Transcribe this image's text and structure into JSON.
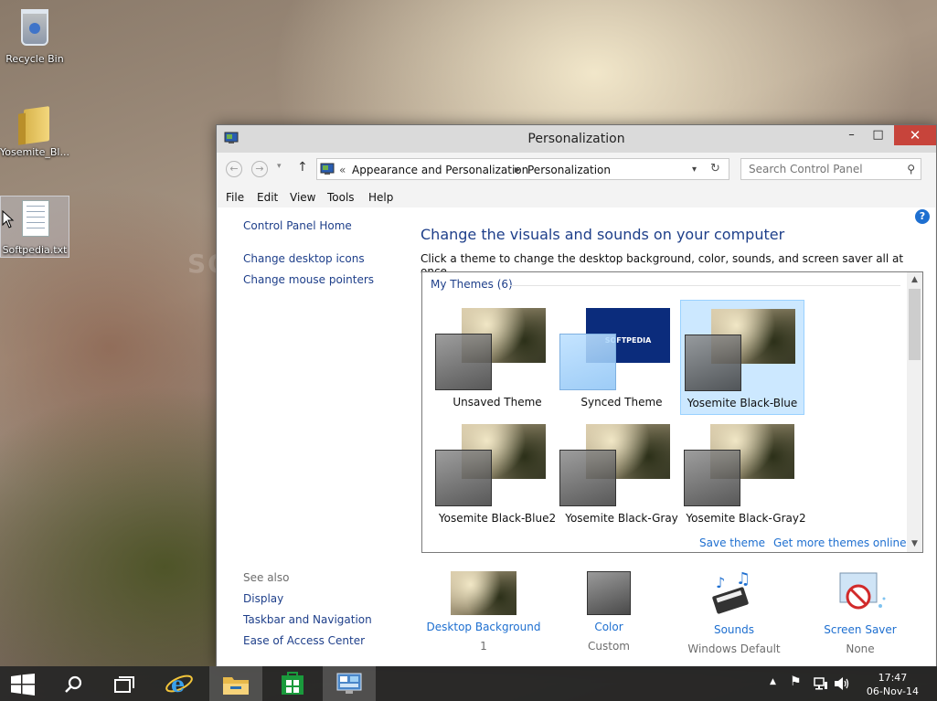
{
  "desktop": {
    "icons": [
      {
        "label": "Recycle Bin",
        "icon": "recycle-bin-icon"
      },
      {
        "label": "Yosemite_Bl...",
        "icon": "folder-icon"
      },
      {
        "label": "Softpedia.txt",
        "icon": "text-file-icon"
      }
    ],
    "watermark": "SOFTPEDIA"
  },
  "window": {
    "title": "Personalization",
    "controls": {
      "minimize": "–",
      "maximize": "□",
      "close": "✕"
    },
    "address": {
      "overflow": "«",
      "crumbs": [
        "Appearance and Personalization",
        "Personalization"
      ]
    },
    "search": {
      "placeholder": "Search Control Panel"
    },
    "menu": [
      "File",
      "Edit",
      "View",
      "Tools",
      "Help"
    ]
  },
  "sidebar": {
    "home": "Control Panel Home",
    "links": [
      "Change desktop icons",
      "Change mouse pointers"
    ],
    "see_also_label": "See also",
    "see_also": [
      "Display",
      "Taskbar and Navigation",
      "Ease of Access Center"
    ]
  },
  "main": {
    "heading": "Change the visuals and sounds on your computer",
    "subtext": "Click a theme to change the desktop background, color, sounds, and screen saver all at once.",
    "group_label": "My Themes (6)",
    "themes": [
      {
        "name": "Unsaved Theme",
        "selected": false
      },
      {
        "name": "Synced Theme",
        "selected": false,
        "thumb_text": "SOFTPEDIA"
      },
      {
        "name": "Yosemite Black-Blue",
        "selected": true
      },
      {
        "name": "Yosemite Black-Blue2",
        "selected": false
      },
      {
        "name": "Yosemite Black-Gray",
        "selected": false
      },
      {
        "name": "Yosemite Black-Gray2",
        "selected": false
      }
    ],
    "save_theme": "Save theme",
    "get_more": "Get more themes online"
  },
  "bottom": [
    {
      "label": "Desktop Background",
      "value": "1",
      "icon": "desktop-background-thumbnail"
    },
    {
      "label": "Color",
      "value": "Custom",
      "icon": "color-swatch"
    },
    {
      "label": "Sounds",
      "value": "Windows Default",
      "icon": "sounds-icon"
    },
    {
      "label": "Screen Saver",
      "value": "None",
      "icon": "screen-saver-icon"
    }
  ],
  "taskbar": {
    "time": "17:47",
    "date": "06-Nov-14"
  },
  "colors": {
    "link": "#1e3f8a",
    "link_bright": "#1e6fd0",
    "close_button": "#c7443b",
    "selection": "#cce8ff"
  }
}
